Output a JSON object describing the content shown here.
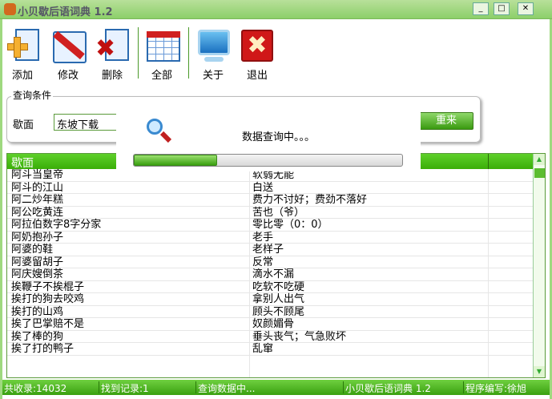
{
  "window": {
    "title": "小贝歇后语词典 1.2"
  },
  "toolbar": [
    {
      "label": "添加",
      "icon": "add-icon"
    },
    {
      "label": "修改",
      "icon": "edit-icon"
    },
    {
      "label": "删除",
      "icon": "delete-icon"
    },
    {
      "label": "全部",
      "icon": "table-icon"
    },
    {
      "label": "关于",
      "icon": "monitor-icon"
    },
    {
      "label": "退出",
      "icon": "exit-icon"
    }
  ],
  "query": {
    "group_label": "查询条件",
    "field_label": "歇面",
    "field_value": "东坡下载",
    "reset_label": "重来"
  },
  "dialog": {
    "message": "数据查询中。。。",
    "progress": 0.31
  },
  "table": {
    "headers": [
      "歇面",
      ""
    ],
    "rows": [
      [
        "阿斗当皇帝",
        "软弱无能"
      ],
      [
        "阿斗的江山",
        "白送"
      ],
      [
        "阿二炒年糕",
        "费力不讨好；费劲不落好"
      ],
      [
        "阿公吃黄连",
        "苦也（爷）"
      ],
      [
        "阿拉伯数字8字分家",
        "零比零（0：0）"
      ],
      [
        "阿奶抱孙子",
        "老手"
      ],
      [
        "阿婆的鞋",
        "老样子"
      ],
      [
        "阿婆留胡子",
        "反常"
      ],
      [
        "阿庆嫂倒茶",
        "滴水不漏"
      ],
      [
        "挨鞭子不挨棍子",
        "吃软不吃硬"
      ],
      [
        "挨打的狗去咬鸡",
        "拿别人出气"
      ],
      [
        "挨打的山鸡",
        "顾头不顾尾"
      ],
      [
        "挨了巴掌赔不是",
        "奴颜媚骨"
      ],
      [
        "挨了棒的狗",
        "垂头丧气；气急败坏"
      ],
      [
        "挨了打的鸭子",
        "乱窜"
      ]
    ]
  },
  "status": [
    "共收录:14032",
    "找到记录:1",
    "查询数据中...",
    "小贝歇后语词典 1.2",
    "程序编写:徐旭"
  ],
  "colors": {
    "accent": "#3aae08"
  }
}
